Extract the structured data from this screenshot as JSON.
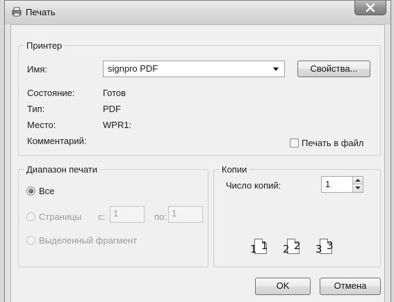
{
  "window": {
    "title": "Печать",
    "icons": {
      "app": "printer-icon",
      "close": "close-icon"
    }
  },
  "printer": {
    "group_label": "Принтер",
    "name_label": "Имя:",
    "name_value": "signpro PDF",
    "properties_button": "Свойства...",
    "status_label": "Состояние:",
    "status_value": "Готов",
    "type_label": "Тип:",
    "type_value": "PDF",
    "where_label": "Место:",
    "where_value": "WPR1:",
    "comment_label": "Комментарий:",
    "print_to_file_label": "Печать в файл",
    "print_to_file_checked": false
  },
  "range": {
    "group_label": "Диапазон печати",
    "all_label": "Все",
    "all_selected": true,
    "pages_label": "Страницы",
    "from_label": "с:",
    "from_value": "1",
    "to_label": "по:",
    "to_value": "1",
    "selection_label": "Выделенный фрагмент"
  },
  "copies": {
    "group_label": "Копии",
    "count_label": "Число копий:",
    "count_value": "1",
    "collate_pages": [
      "1",
      "1",
      "2",
      "2",
      "3",
      "3"
    ]
  },
  "footer": {
    "ok_label": "OK",
    "cancel_label": "Отмена"
  },
  "colors": {
    "window_frame": "#e3e3e3",
    "client_bg": "#f0f0f0",
    "disabled_text": "#9a9a9a"
  }
}
